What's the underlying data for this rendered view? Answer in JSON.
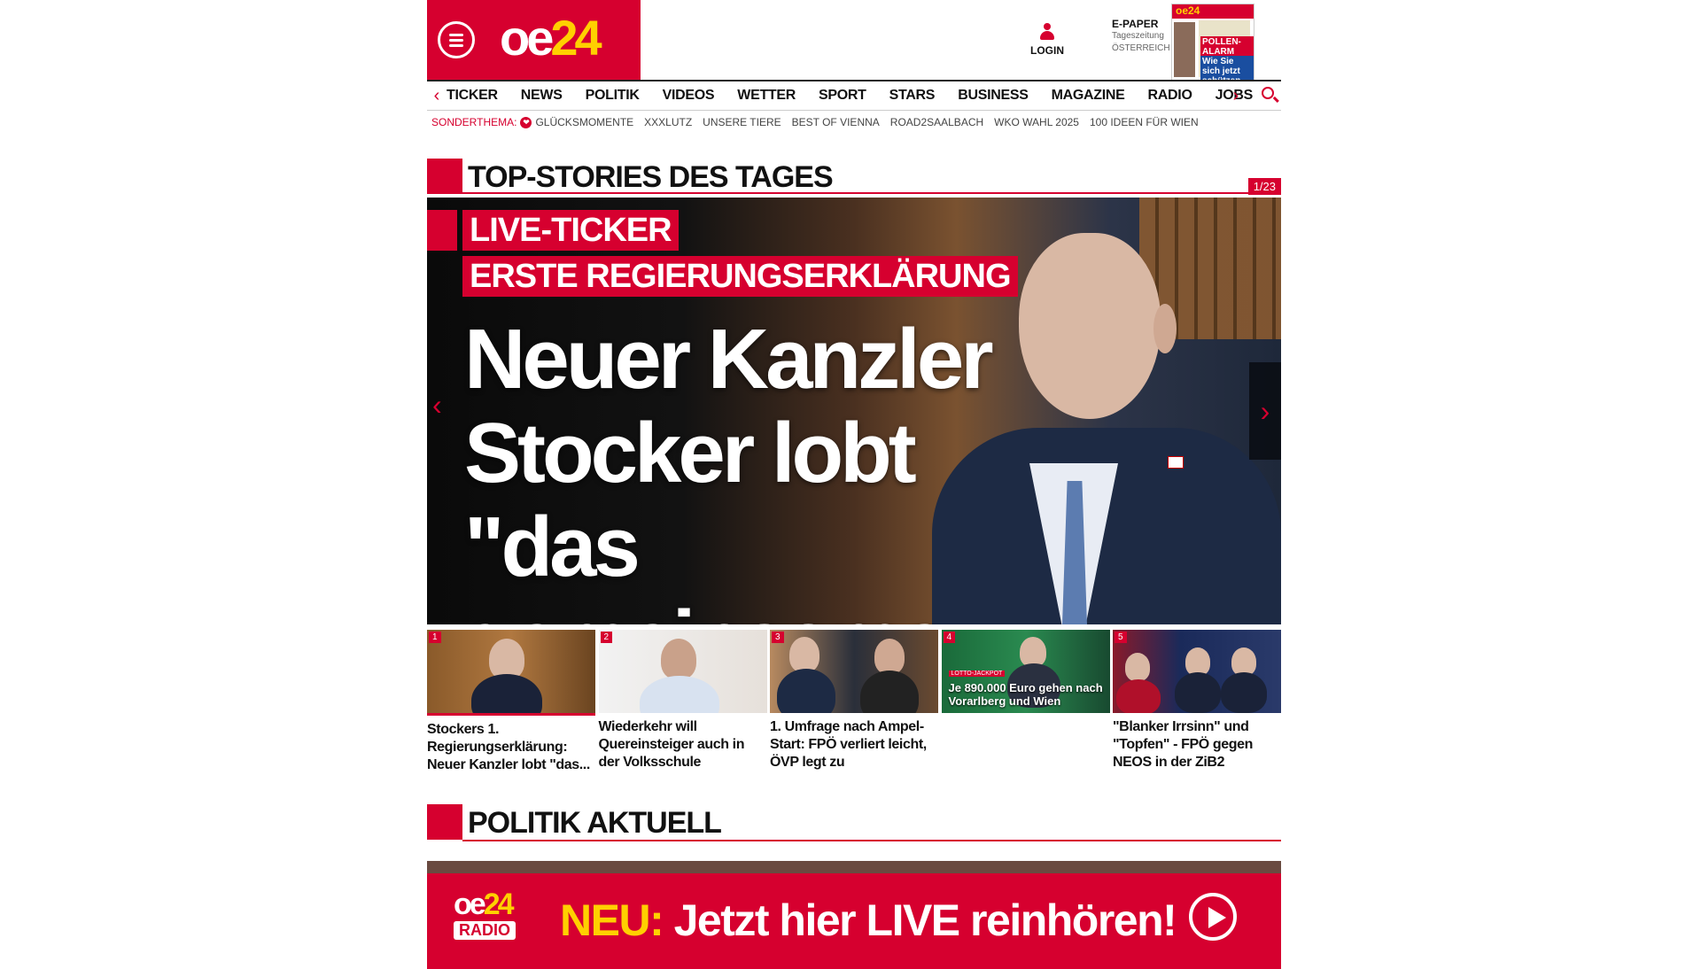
{
  "header": {
    "logo": {
      "left": "oe",
      "right": "24"
    },
    "login_label": "LOGIN",
    "epaper": {
      "title": "E-PAPER",
      "line1": "Tageszeitung",
      "line2": "ÖSTERREICH"
    }
  },
  "nav": {
    "items": [
      "TICKER",
      "NEWS",
      "POLITIK",
      "VIDEOS",
      "WETTER",
      "SPORT",
      "STARS",
      "BUSINESS",
      "MAGAZINE",
      "RADIO",
      "JOBS"
    ],
    "left_arrow": "‹",
    "right_arrow": "›"
  },
  "sonderthema": {
    "label": "SONDERTHEMA:",
    "items": [
      "GLÜCKSMOMENTE",
      "XXXLUTZ",
      "UNSERE TIERE",
      "BEST OF VIENNA",
      "ROAD2SAALBACH",
      "WKO WAHL 2025",
      "100 IDEEN FÜR WIEN"
    ]
  },
  "top_stories": {
    "title": "TOP-STORIES DES TAGES",
    "counter": "1/23",
    "hero": {
      "tag1": "LIVE-TICKER",
      "tag2": "ERSTE REGIERUNGSERKLÄRUNG",
      "headline": "Neuer Kanzler Stocker lobt \"das gemeinsame Bier\""
    },
    "thumbs": [
      {
        "num": "1",
        "caption": "Stockers 1. Regierungserklärung: Neuer Kanzler lobt \"das..."
      },
      {
        "num": "2",
        "caption": "Wiederkehr will Quereinsteiger auch in der Volksschule"
      },
      {
        "num": "3",
        "caption": "1. Umfrage nach Ampel-Start: FPÖ verliert leicht, ÖVP legt zu"
      },
      {
        "num": "4",
        "caption": "",
        "overlay_label": "LOTTO-JACKPOT",
        "overlay_text": "Je 890.000 Euro gehen nach Vorarlberg und Wien"
      },
      {
        "num": "5",
        "caption": "\"Blanker Irrsinn\" und \"Topfen\" - FPÖ gegen NEOS in der ZiB2"
      }
    ]
  },
  "politik": {
    "title": "POLITIK AKTUELL"
  },
  "radio_banner": {
    "logo_top_left": "oe",
    "logo_top_right": "24",
    "logo_bottom": "RADIO",
    "neu": "NEU:",
    "text": "Jetzt hier LIVE reinhören!"
  },
  "colors": {
    "brand_red": "#d6002f",
    "brand_yellow": "#ffd000"
  }
}
